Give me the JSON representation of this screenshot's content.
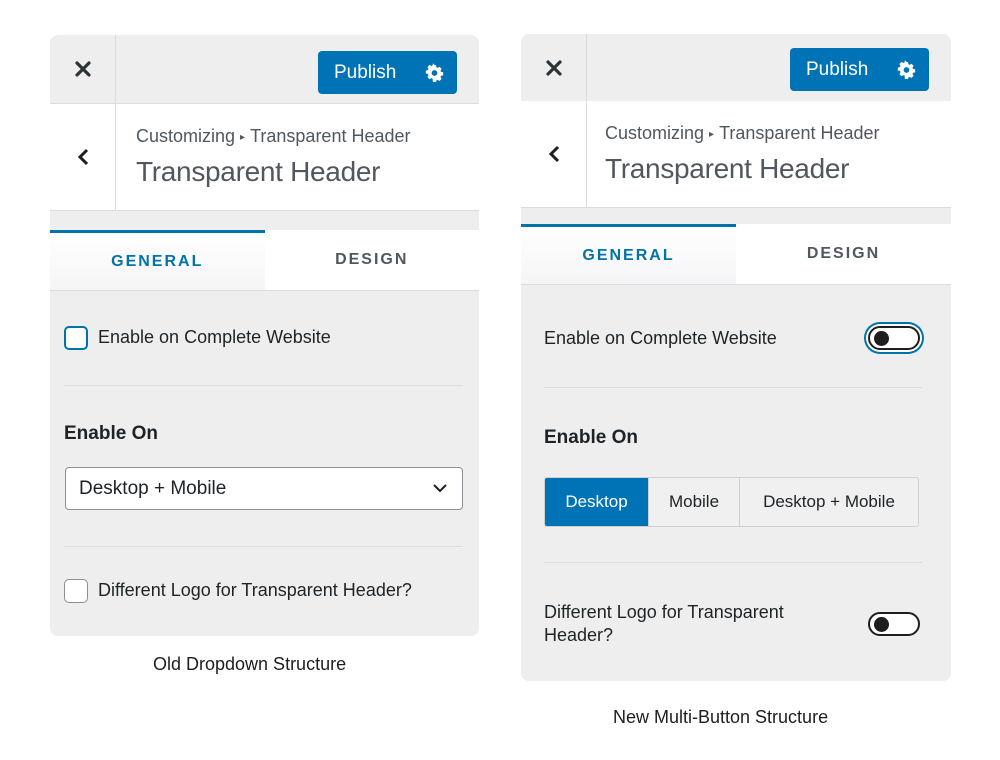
{
  "colors": {
    "accent": "#0073b6",
    "panel_bg": "#eeeeee",
    "tab_active": "#0073aa"
  },
  "old_panel": {
    "caption": "Old Dropdown Structure",
    "topbar": {
      "close_icon": "close-icon",
      "publish_label": "Publish",
      "settings_icon": "gear-icon"
    },
    "header": {
      "back_icon": "chevron-left-icon",
      "breadcrumb_root": "Customizing",
      "breadcrumb_separator": "▸",
      "breadcrumb_current": "Transparent Header",
      "title": "Transparent Header"
    },
    "tabs": [
      {
        "label": "GENERAL",
        "active": true
      },
      {
        "label": "DESIGN",
        "active": false
      }
    ],
    "enable_complete": {
      "label": "Enable on Complete Website",
      "checked": false
    },
    "enable_on": {
      "heading": "Enable On",
      "selected": "Desktop + Mobile"
    },
    "different_logo": {
      "label": "Different Logo for Transparent Header?",
      "checked": false
    }
  },
  "new_panel": {
    "caption": "New Multi-Button Structure",
    "topbar": {
      "close_icon": "close-icon",
      "publish_label": "Publish",
      "settings_icon": "gear-icon"
    },
    "header": {
      "back_icon": "chevron-left-icon",
      "breadcrumb_root": "Customizing",
      "breadcrumb_separator": "▸",
      "breadcrumb_current": "Transparent Header",
      "title": "Transparent Header"
    },
    "tabs": [
      {
        "label": "GENERAL",
        "active": true
      },
      {
        "label": "DESIGN",
        "active": false
      }
    ],
    "enable_complete": {
      "label": "Enable on Complete Website",
      "on": false
    },
    "enable_on": {
      "heading": "Enable On",
      "options": [
        {
          "label": "Desktop",
          "active": true
        },
        {
          "label": "Mobile",
          "active": false
        },
        {
          "label": "Desktop + Mobile",
          "active": false
        }
      ]
    },
    "different_logo": {
      "label_line1": "Different Logo for Transparent",
      "label_line2": "Header?",
      "on": false
    }
  }
}
